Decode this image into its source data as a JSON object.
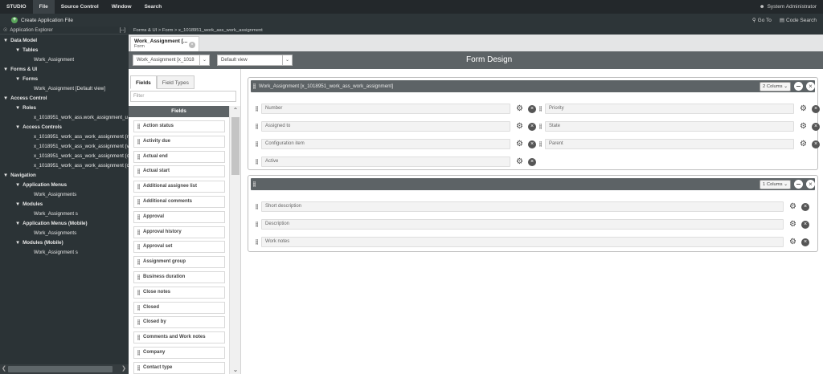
{
  "menu": {
    "items": [
      "STUDIO",
      "File",
      "Source Control",
      "Window",
      "Search"
    ],
    "user": "System Administrator"
  },
  "toolbar": {
    "create": "Create Application File",
    "goto": "Go To",
    "code_search": "Code Search"
  },
  "explorer": {
    "title": "Application Explorer",
    "collapse": "[--]",
    "tree": [
      {
        "label": "Data Model",
        "bold": true,
        "indent": 0,
        "arrow": "▼"
      },
      {
        "label": "Tables",
        "bold": true,
        "indent": 1,
        "arrow": "▼"
      },
      {
        "label": "Work_Assignment",
        "bold": false,
        "indent": 2,
        "arrow": ""
      },
      {
        "label": "Forms & UI",
        "bold": true,
        "indent": 0,
        "arrow": "▼"
      },
      {
        "label": "Forms",
        "bold": true,
        "indent": 1,
        "arrow": "▼"
      },
      {
        "label": "Work_Assignment [Default view]",
        "bold": false,
        "indent": 2,
        "arrow": ""
      },
      {
        "label": "Access Control",
        "bold": true,
        "indent": 0,
        "arrow": "▼"
      },
      {
        "label": "Roles",
        "bold": true,
        "indent": 1,
        "arrow": "▼"
      },
      {
        "label": "x_1018951_work_ass.work_assignment_u",
        "bold": false,
        "indent": 2,
        "arrow": ""
      },
      {
        "label": "Access Controls",
        "bold": true,
        "indent": 1,
        "arrow": "▼"
      },
      {
        "label": "x_1018951_work_ass_work_assignment (r",
        "bold": false,
        "indent": 2,
        "arrow": ""
      },
      {
        "label": "x_1018951_work_ass_work_assignment (v",
        "bold": false,
        "indent": 2,
        "arrow": ""
      },
      {
        "label": "x_1018951_work_ass_work_assignment (c",
        "bold": false,
        "indent": 2,
        "arrow": ""
      },
      {
        "label": "x_1018951_work_ass_work_assignment (c",
        "bold": false,
        "indent": 2,
        "arrow": ""
      },
      {
        "label": "Navigation",
        "bold": true,
        "indent": 0,
        "arrow": "▼"
      },
      {
        "label": "Application Menus",
        "bold": true,
        "indent": 1,
        "arrow": "▼"
      },
      {
        "label": "Work_Assignments",
        "bold": false,
        "indent": 2,
        "arrow": ""
      },
      {
        "label": "Modules",
        "bold": true,
        "indent": 1,
        "arrow": "▼"
      },
      {
        "label": "Work_Assignment s",
        "bold": false,
        "indent": 2,
        "arrow": ""
      },
      {
        "label": "Application Menus (Mobile)",
        "bold": true,
        "indent": 1,
        "arrow": "▼"
      },
      {
        "label": "Work_Assignments",
        "bold": false,
        "indent": 2,
        "arrow": ""
      },
      {
        "label": "Modules (Mobile)",
        "bold": true,
        "indent": 1,
        "arrow": "▼"
      },
      {
        "label": "Work_Assignment s",
        "bold": false,
        "indent": 2,
        "arrow": ""
      }
    ]
  },
  "breadcrumb": "Forms & UI > Form > x_1018951_work_ass_work_assignment",
  "tab": {
    "title": "Work_Assignment [...",
    "subtitle": "Form"
  },
  "designer": {
    "table_select": "Work_Assignment [x_1018",
    "view_select": "Default view",
    "title": "Form Design"
  },
  "palette": {
    "tabs": [
      "Fields",
      "Field Types"
    ],
    "filter_placeholder": "Filter",
    "header": "Fields",
    "fields": [
      "Action status",
      "Activity due",
      "Actual end",
      "Actual start",
      "Additional assignee list",
      "Additional comments",
      "Approval",
      "Approval history",
      "Approval set",
      "Assignment group",
      "Business duration",
      "Close notes",
      "Closed",
      "Closed by",
      "Comments and Work notes",
      "Company",
      "Contact type"
    ]
  },
  "sections": [
    {
      "title": "Work_Assignment  [x_1018951_work_ass_work_assignment]",
      "columns": "2 Colums",
      "left": [
        "Number",
        "Assigned to",
        "Configuration item",
        "Active"
      ],
      "right": [
        "Priority",
        "State",
        "Parent"
      ]
    },
    {
      "title": "",
      "columns": "1 Colums",
      "left": [
        "Short description",
        "Description",
        "Work notes"
      ],
      "right": []
    }
  ]
}
